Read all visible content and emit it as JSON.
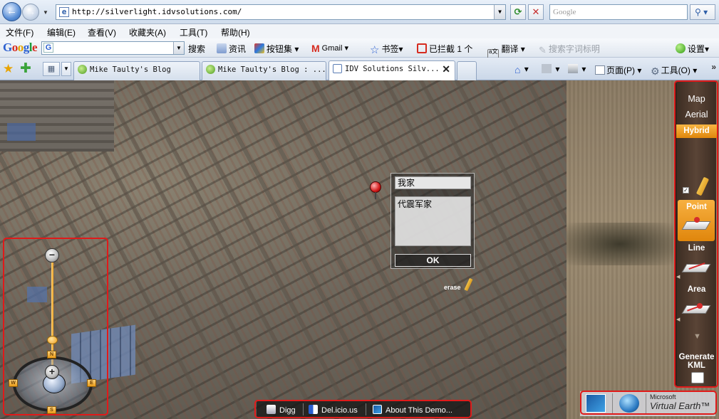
{
  "browser": {
    "url": "http://silverlight.idvsolutions.com/",
    "search_placeholder": "Google",
    "menu": [
      "文件(F)",
      "编辑(E)",
      "查看(V)",
      "收藏夹(A)",
      "工具(T)",
      "帮助(H)"
    ],
    "google_toolbar": {
      "logo_letters": [
        "G",
        "o",
        "o",
        "g",
        "l",
        "e"
      ],
      "search_button": "搜索",
      "items": [
        "资讯",
        "按钮集",
        "Gmail",
        "书签",
        "已拦截 1 个",
        "翻译",
        "搜索字词标明",
        "设置"
      ]
    },
    "tabs": [
      {
        "title": "Mike Taulty's Blog"
      },
      {
        "title": "Mike Taulty's Blog : ..."
      },
      {
        "title": "IDV Solutions Silv..."
      }
    ],
    "command_bar": {
      "page_label": "页面(P)",
      "tools_label": "工具(O)"
    }
  },
  "map": {
    "mode_options": [
      "Map",
      "Aerial",
      "Hybrid"
    ],
    "active_mode": "Hybrid",
    "tools": {
      "point": "Point",
      "line": "Line",
      "area": "Area",
      "generate_kml": [
        "Generate",
        "KML"
      ]
    },
    "popup": {
      "title_value": "我家",
      "description_value": "代震军家",
      "ok_label": "OK"
    },
    "erase_label": "erase",
    "nav": {
      "minus": "−",
      "plus": "+",
      "dirs": [
        "N",
        "W",
        "E",
        "S"
      ]
    },
    "bottom_links": [
      "Digg",
      "Del.icio.us",
      "About This Demo..."
    ],
    "brand": {
      "line1": "Microsoft",
      "line2": "Virtual Earth™"
    }
  },
  "colors": {
    "highlight": "#e01a1a",
    "active_orange": "#f0a020",
    "panel_brown": "#4a3629"
  }
}
